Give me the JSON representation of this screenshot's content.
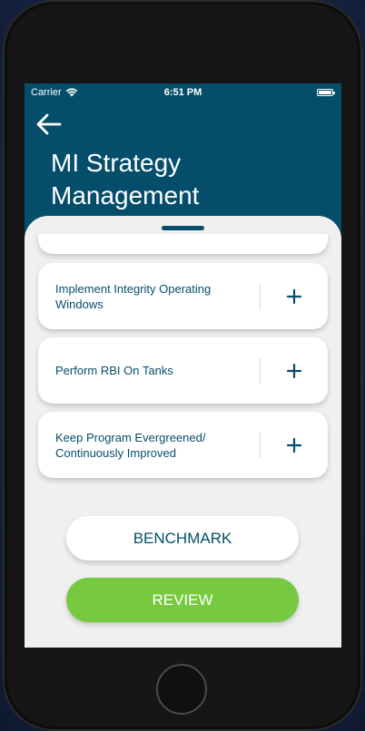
{
  "status_bar": {
    "carrier": "Carrier",
    "time": "6:51 PM"
  },
  "header": {
    "title_line1": "MI Strategy",
    "title_line2": "Management"
  },
  "tasks": [
    {
      "label": "Implement Integrity Operating Windows",
      "action_icon": "plus-icon"
    },
    {
      "label": "Perform RBI On Tanks",
      "action_icon": "plus-icon"
    },
    {
      "label": "Keep Program Evergreened/ Continuously Improved",
      "action_icon": "plus-icon"
    }
  ],
  "buttons": {
    "benchmark": "BENCHMARK",
    "review": "REVIEW"
  },
  "colors": {
    "brand": "#054e6b",
    "review_green": "#77c93f",
    "sheet_background": "#f0f0f0",
    "card_background": "#ffffff"
  }
}
